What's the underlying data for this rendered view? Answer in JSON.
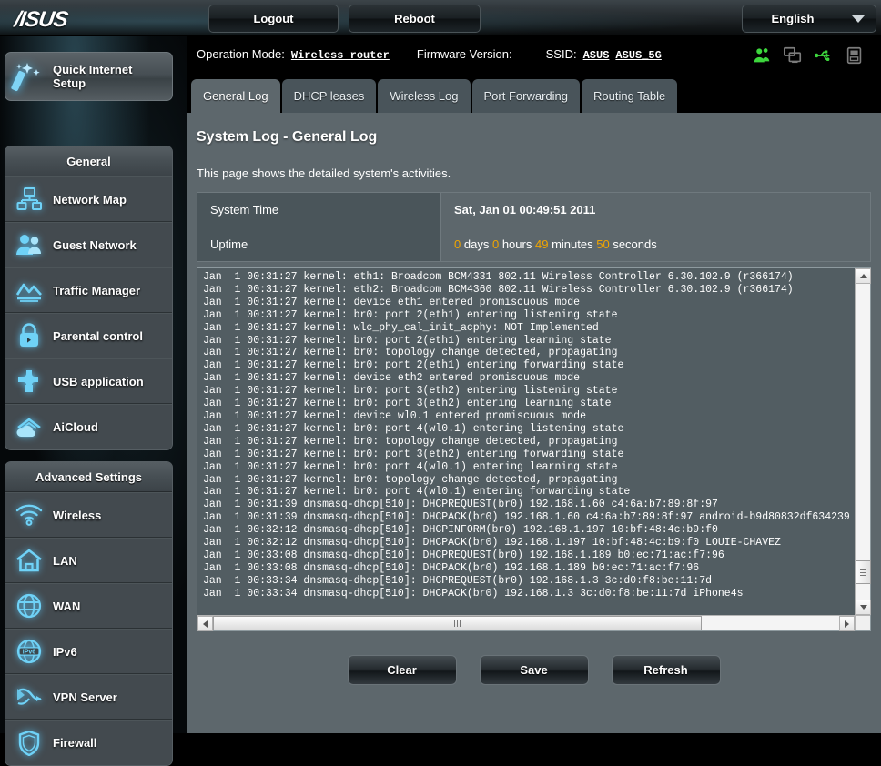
{
  "brand": {
    "logo_text": "/ISUS"
  },
  "topbar": {
    "logout_label": "Logout",
    "reboot_label": "Reboot",
    "language_label": "English"
  },
  "infobar": {
    "operation_mode_label": "Operation Mode:",
    "operation_mode_value": "Wireless router",
    "firmware_label": "Firmware Version:",
    "firmware_value": "",
    "ssid_label": "SSID:",
    "ssid_1": "ASUS",
    "ssid_2": "ASUS_5G",
    "status_icons": [
      {
        "name": "clients-icon",
        "color": "#3dd63d"
      },
      {
        "name": "devices-icon",
        "color": "#7b7b7b"
      },
      {
        "name": "usb-icon",
        "color": "#3dd63d"
      },
      {
        "name": "printer-icon",
        "color": "#7b7b7b"
      }
    ]
  },
  "sidebar": {
    "quick_setup_label": "Quick Internet Setup",
    "groups": [
      {
        "title": "General",
        "items": [
          {
            "label": "Network Map",
            "icon": "network-map-icon"
          },
          {
            "label": "Guest Network",
            "icon": "guest-network-icon"
          },
          {
            "label": "Traffic Manager",
            "icon": "traffic-manager-icon"
          },
          {
            "label": "Parental control",
            "icon": "parental-control-icon"
          },
          {
            "label": "USB application",
            "icon": "usb-application-icon"
          },
          {
            "label": "AiCloud",
            "icon": "aicloud-icon"
          }
        ]
      },
      {
        "title": "Advanced Settings",
        "items": [
          {
            "label": "Wireless",
            "icon": "wireless-icon"
          },
          {
            "label": "LAN",
            "icon": "lan-icon"
          },
          {
            "label": "WAN",
            "icon": "wan-icon"
          },
          {
            "label": "IPv6",
            "icon": "ipv6-icon"
          },
          {
            "label": "VPN Server",
            "icon": "vpn-server-icon"
          },
          {
            "label": "Firewall",
            "icon": "firewall-icon"
          }
        ]
      }
    ]
  },
  "main": {
    "tabs": [
      {
        "label": "General Log",
        "active": true
      },
      {
        "label": "DHCP leases",
        "active": false
      },
      {
        "label": "Wireless Log",
        "active": false
      },
      {
        "label": "Port Forwarding",
        "active": false
      },
      {
        "label": "Routing Table",
        "active": false
      }
    ],
    "page_title": "System Log - General Log",
    "page_description": "This page shows the detailed system's activities.",
    "info_table": {
      "system_time_label": "System Time",
      "system_time_value": "Sat, Jan 01  00:49:51  2011",
      "uptime_label": "Uptime",
      "uptime": {
        "days": "0",
        "days_unit": "days",
        "hours": "0",
        "hours_unit": "hours",
        "minutes": "49",
        "minutes_unit": "minutes",
        "seconds": "50",
        "seconds_unit": "seconds"
      }
    },
    "log_lines": "Jan  1 00:31:27 kernel: eth1: Broadcom BCM4331 802.11 Wireless Controller 6.30.102.9 (r366174)\nJan  1 00:31:27 kernel: eth2: Broadcom BCM4360 802.11 Wireless Controller 6.30.102.9 (r366174)\nJan  1 00:31:27 kernel: device eth1 entered promiscuous mode\nJan  1 00:31:27 kernel: br0: port 2(eth1) entering listening state\nJan  1 00:31:27 kernel: wlc_phy_cal_init_acphy: NOT Implemented\nJan  1 00:31:27 kernel: br0: port 2(eth1) entering learning state\nJan  1 00:31:27 kernel: br0: topology change detected, propagating\nJan  1 00:31:27 kernel: br0: port 2(eth1) entering forwarding state\nJan  1 00:31:27 kernel: device eth2 entered promiscuous mode\nJan  1 00:31:27 kernel: br0: port 3(eth2) entering listening state\nJan  1 00:31:27 kernel: br0: port 3(eth2) entering learning state\nJan  1 00:31:27 kernel: device wl0.1 entered promiscuous mode\nJan  1 00:31:27 kernel: br0: port 4(wl0.1) entering listening state\nJan  1 00:31:27 kernel: br0: topology change detected, propagating\nJan  1 00:31:27 kernel: br0: port 3(eth2) entering forwarding state\nJan  1 00:31:27 kernel: br0: port 4(wl0.1) entering learning state\nJan  1 00:31:27 kernel: br0: topology change detected, propagating\nJan  1 00:31:27 kernel: br0: port 4(wl0.1) entering forwarding state\nJan  1 00:31:39 dnsmasq-dhcp[510]: DHCPREQUEST(br0) 192.168.1.60 c4:6a:b7:89:8f:97\nJan  1 00:31:39 dnsmasq-dhcp[510]: DHCPACK(br0) 192.168.1.60 c4:6a:b7:89:8f:97 android-b9d80832df634239\nJan  1 00:32:12 dnsmasq-dhcp[510]: DHCPINFORM(br0) 192.168.1.197 10:bf:48:4c:b9:f0\nJan  1 00:32:12 dnsmasq-dhcp[510]: DHCPACK(br0) 192.168.1.197 10:bf:48:4c:b9:f0 LOUIE-CHAVEZ\nJan  1 00:33:08 dnsmasq-dhcp[510]: DHCPREQUEST(br0) 192.168.1.189 b0:ec:71:ac:f7:96\nJan  1 00:33:08 dnsmasq-dhcp[510]: DHCPACK(br0) 192.168.1.189 b0:ec:71:ac:f7:96\nJan  1 00:33:34 dnsmasq-dhcp[510]: DHCPREQUEST(br0) 192.168.1.3 3c:d0:f8:be:11:7d\nJan  1 00:33:34 dnsmasq-dhcp[510]: DHCPACK(br0) 192.168.1.3 3c:d0:f8:be:11:7d iPhone4s",
    "buttons": {
      "clear_label": "Clear",
      "save_label": "Save",
      "refresh_label": "Refresh"
    }
  },
  "colors": {
    "panel_bg": "#5d676c",
    "accent_orange": "#f0a500",
    "icon_glow": "#5ac8fa",
    "status_green": "#3dd63d"
  }
}
